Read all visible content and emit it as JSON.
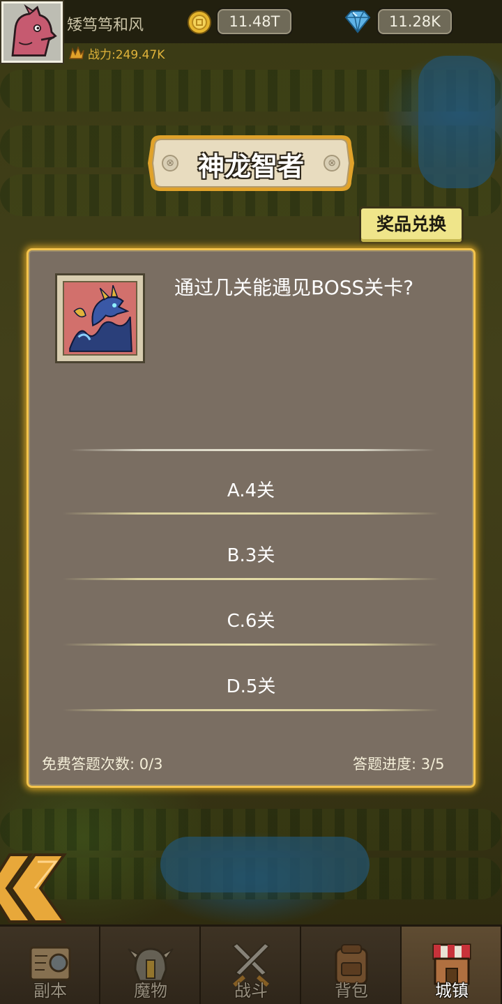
{
  "player": {
    "name": "矮笃笃和风",
    "power": "战力:249.47K"
  },
  "currency": {
    "gold": "11.48T",
    "gems": "11.28K"
  },
  "banner": {
    "title": "神龙智者"
  },
  "exchange_button": "奖品兑换",
  "quiz": {
    "question": "通过几关能遇见BOSS关卡?",
    "options": [
      {
        "label": "A.4关"
      },
      {
        "label": "B.3关"
      },
      {
        "label": "C.6关"
      },
      {
        "label": "D.5关"
      }
    ],
    "free_attempts": "免费答题次数: 0/3",
    "progress": "答题进度: 3/5"
  },
  "nav": {
    "items": [
      {
        "label": "副本",
        "icon": "map-scroll-icon"
      },
      {
        "label": "魔物",
        "icon": "monster-helmet-icon"
      },
      {
        "label": "战斗",
        "icon": "crossed-swords-icon"
      },
      {
        "label": "背包",
        "icon": "backpack-icon"
      },
      {
        "label": "城镇",
        "icon": "town-shop-icon"
      }
    ],
    "active": "城镇"
  },
  "colors": {
    "panel_border": "#f4c44d",
    "panel_bg": "#7a6e62",
    "power_text": "#e0b33a",
    "exchange_bg": "#efe58a"
  }
}
